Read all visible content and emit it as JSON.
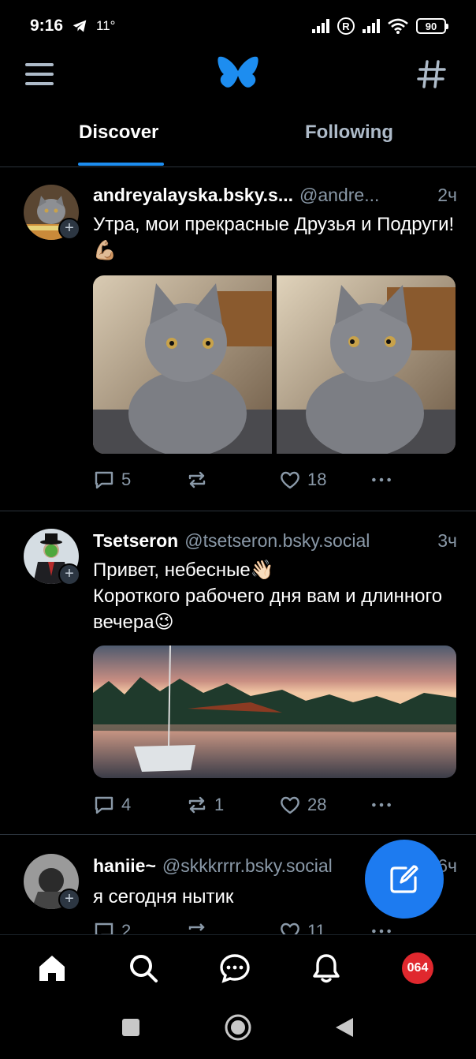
{
  "status_bar": {
    "time": "9:16",
    "temperature": "11°",
    "battery": "90"
  },
  "tabs": [
    {
      "label": "Discover",
      "active": true
    },
    {
      "label": "Following",
      "active": false
    }
  ],
  "posts": [
    {
      "name": "andreyalayska.bsky.s...",
      "handle": "@andre...",
      "time": "2ч",
      "text": "Утра, мои прекрасные Друзья и Подруги!💪🏼",
      "replies": "5",
      "reposts": "",
      "likes": "18"
    },
    {
      "name": "Tsetseron",
      "handle": "@tsetseron.bsky.social",
      "time": "3ч",
      "text": "Привет, небесные👋🏻\nКороткого рабочего дня вам и длинного вечера😉",
      "replies": "4",
      "reposts": "1",
      "likes": "28"
    },
    {
      "name": "haniie~",
      "handle": "@skkkrrrr.bsky.social",
      "time": "6ч",
      "text": "я сегодня нытик",
      "replies": "2",
      "reposts": "",
      "likes": "11"
    }
  ],
  "nav": {
    "profile_badge": "064"
  },
  "colors": {
    "accent": "#1d8df0",
    "fab": "#1d7bf0",
    "muted": "#8a99a8",
    "badge": "#e0282e"
  },
  "icons": [
    "menu-icon",
    "butterfly-logo-icon",
    "hash-icon",
    "plus-icon",
    "reply-icon",
    "repost-icon",
    "like-icon",
    "more-icon",
    "compose-icon",
    "home-icon",
    "search-icon",
    "chat-icon",
    "bell-icon"
  ]
}
